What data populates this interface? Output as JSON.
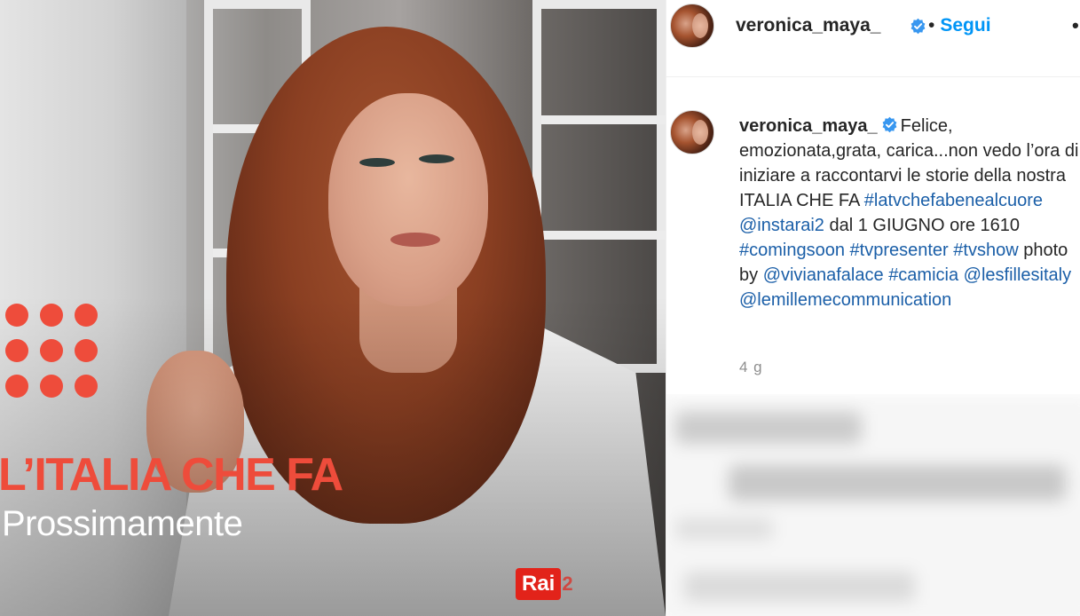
{
  "media": {
    "show_title": "L’ITALIA CHE FA",
    "show_subtitle": "Prossimamente",
    "logo_text": "Rai",
    "logo_number": "2",
    "accent_color": "#ee4c3b",
    "logo_color": "#e2231a"
  },
  "header": {
    "username": "veronica_maya_",
    "separator": "•",
    "follow_label": "Segui",
    "more_icon": "more-dots-icon",
    "follow_color": "#0095f6"
  },
  "caption": {
    "username": "veronica_maya_",
    "text_1": "Felice, emozionata,grata, carica...non vedo l’ora di iniziare a raccontarvi le storie della nostra ITALIA CHE FA",
    "tag_1": "#latvchefabenealcuore",
    "tag_2": "@instarai2",
    "text_2": "dal 1 GIUGNO ore 1610",
    "tag_3": "#comingsoon",
    "tag_4": "#tvpresenter",
    "tag_5": "#tvshow",
    "text_3": "photo by",
    "tag_6": "@vivianafalace",
    "tag_7": "#camicia",
    "tag_8": "@lesfillesitaly",
    "tag_9": "@lemillemecommunication",
    "tag_color": "#1b5fa8"
  },
  "time_ago": "4 g"
}
